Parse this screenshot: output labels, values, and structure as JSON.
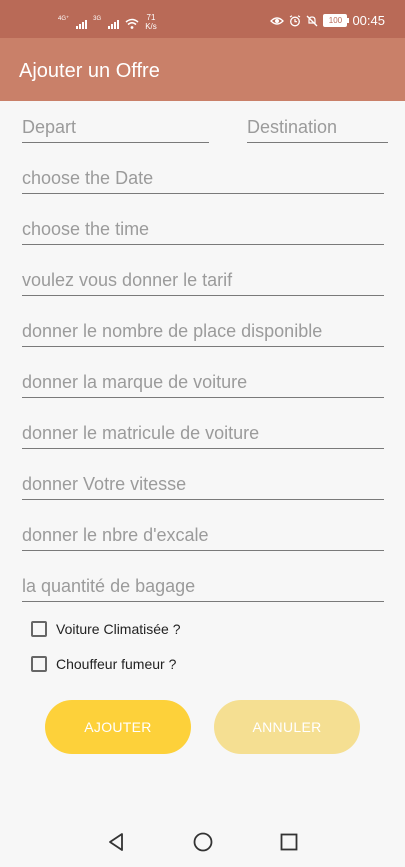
{
  "status_bar": {
    "network_1": "4G⁺",
    "network_2": "3G",
    "speed_value": "71",
    "speed_unit": "K/s",
    "battery": "100",
    "time": "00:45"
  },
  "app_bar": {
    "title": "Ajouter un Offre"
  },
  "form": {
    "departure_placeholder": "Depart",
    "destination_placeholder": "Destination",
    "date_placeholder": "choose the Date",
    "time_placeholder": "choose the time",
    "fare_placeholder": "voulez vous donner le tarif",
    "seats_placeholder": "donner le nombre de place disponible",
    "car_brand_placeholder": "donner la marque de voiture",
    "car_plate_placeholder": "donner le matricule de voiture",
    "speed_placeholder": "donner Votre vitesse",
    "stops_placeholder": "donner le nbre d'excale",
    "luggage_placeholder": "la quantité de bagage",
    "air_conditioned_label": "Voiture Climatisée ?",
    "smoker_driver_label": "Chouffeur fumeur ?",
    "add_button": "AJOUTER",
    "cancel_button": "ANNULER"
  },
  "icons": {
    "status": [
      "signal-icon",
      "wifi-icon",
      "eye-icon",
      "alarm-icon",
      "mute-icon",
      "battery-icon"
    ],
    "navigation": [
      "back-icon",
      "home-icon",
      "recents-icon"
    ]
  },
  "colors": {
    "status_bar": "#b96a57",
    "app_bar": "#c98069",
    "primary_button": "#fdd13a",
    "secondary_button": "#f5df92"
  }
}
